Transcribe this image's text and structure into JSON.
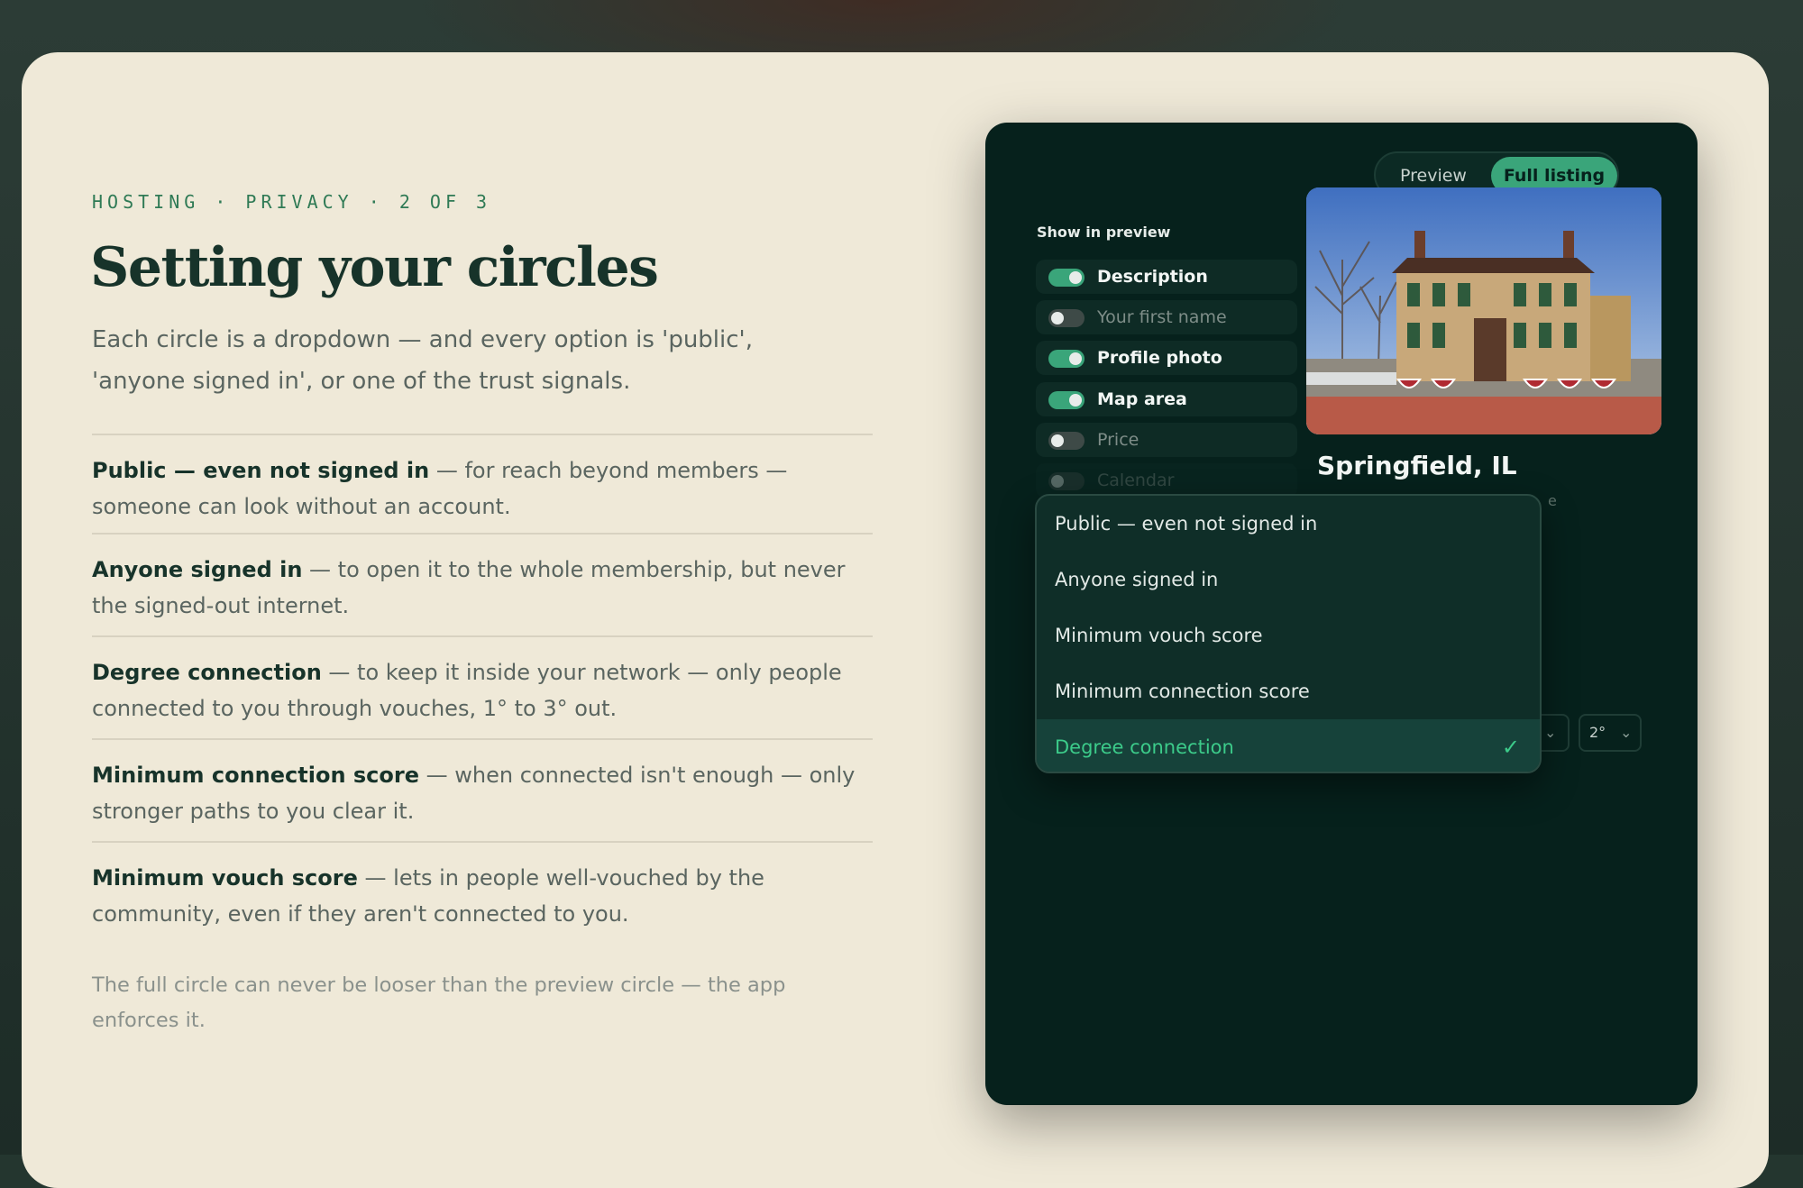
{
  "left": {
    "eyebrow": "HOSTING · PRIVACY · 2 OF 3",
    "title": "Setting your circles",
    "lede": "Each circle is a dropdown — and every option is 'public', 'anyone signed in', or one of the trust signals.",
    "rows": [
      {
        "term": "Public — even not signed in",
        "desc": " — for reach beyond members — someone can look without an account."
      },
      {
        "term": "Anyone signed in",
        "desc": " — to open it to the whole membership, but never the signed-out internet."
      },
      {
        "term": "Degree connection",
        "desc": " — to keep it inside your network — only people connected to you through vouches, 1° to 3° out."
      },
      {
        "term": "Minimum connection score",
        "desc": " — when connected isn't enough — only stronger paths to you clear it."
      },
      {
        "term": "Minimum vouch score",
        "desc": " — lets in people well-vouched by the community, even if they aren't connected to you."
      }
    ],
    "footnote": "The full circle can never be looser than the preview circle — the app enforces it."
  },
  "panel": {
    "segment": {
      "preview": "Preview",
      "full": "Full listing",
      "active": "Full listing"
    },
    "show_label": "Show in preview",
    "toggles": [
      {
        "label": "Description",
        "on": true
      },
      {
        "label": "Your first name",
        "on": false
      },
      {
        "label": "Profile photo",
        "on": true
      },
      {
        "label": "Map area",
        "on": true
      },
      {
        "label": "Price",
        "on": false
      },
      {
        "label": "Calendar",
        "on": false
      }
    ],
    "city": "Springfield, IL",
    "ghost_text": "e",
    "degree_select": "2°"
  },
  "dropdown": {
    "options": [
      "Public — even not signed in",
      "Anyone signed in",
      "Minimum vouch score",
      "Minimum connection score",
      "Degree connection"
    ],
    "selected": "Degree connection"
  },
  "colors": {
    "accent": "#3aa57a",
    "card": "#efe9d8",
    "panel": "#06211c",
    "heading": "#17332a"
  }
}
